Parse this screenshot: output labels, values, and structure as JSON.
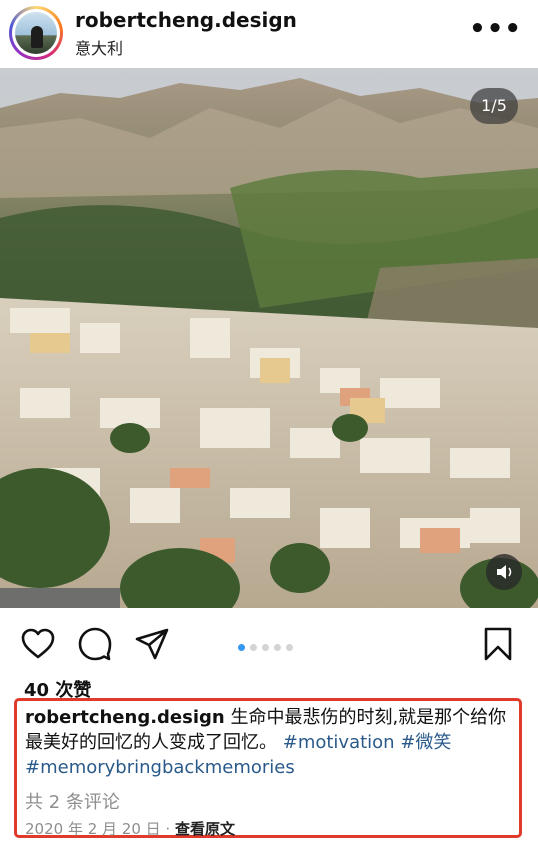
{
  "header": {
    "username": "robertcheng.design",
    "location": "意大利",
    "more_icon": "•••"
  },
  "photo": {
    "counter": "1/5",
    "sound_icon": "speaker-icon"
  },
  "actions": {
    "icons": [
      "heart-icon",
      "comment-icon",
      "share-icon",
      "bookmark-icon"
    ],
    "carousel_total": 5,
    "carousel_active": 1
  },
  "likes": "40 次赞",
  "caption": {
    "username": "robertcheng.design",
    "text": " 生命中最悲伤的时刻,就是那个给你最美好的回忆的人变成了回忆。 ",
    "tag1": "#motivation",
    "tag2": "#微笑",
    "tag3": "#memorybringbackmemories"
  },
  "comments": "共 2 条评论",
  "date": "2020 年 2 月 20 日",
  "separator": " · ",
  "see_translation": "查看原文",
  "colors": {
    "highlight_border": "#e13a2b",
    "hashtag": "#2a5a8a",
    "active_dot": "#3797f0"
  }
}
